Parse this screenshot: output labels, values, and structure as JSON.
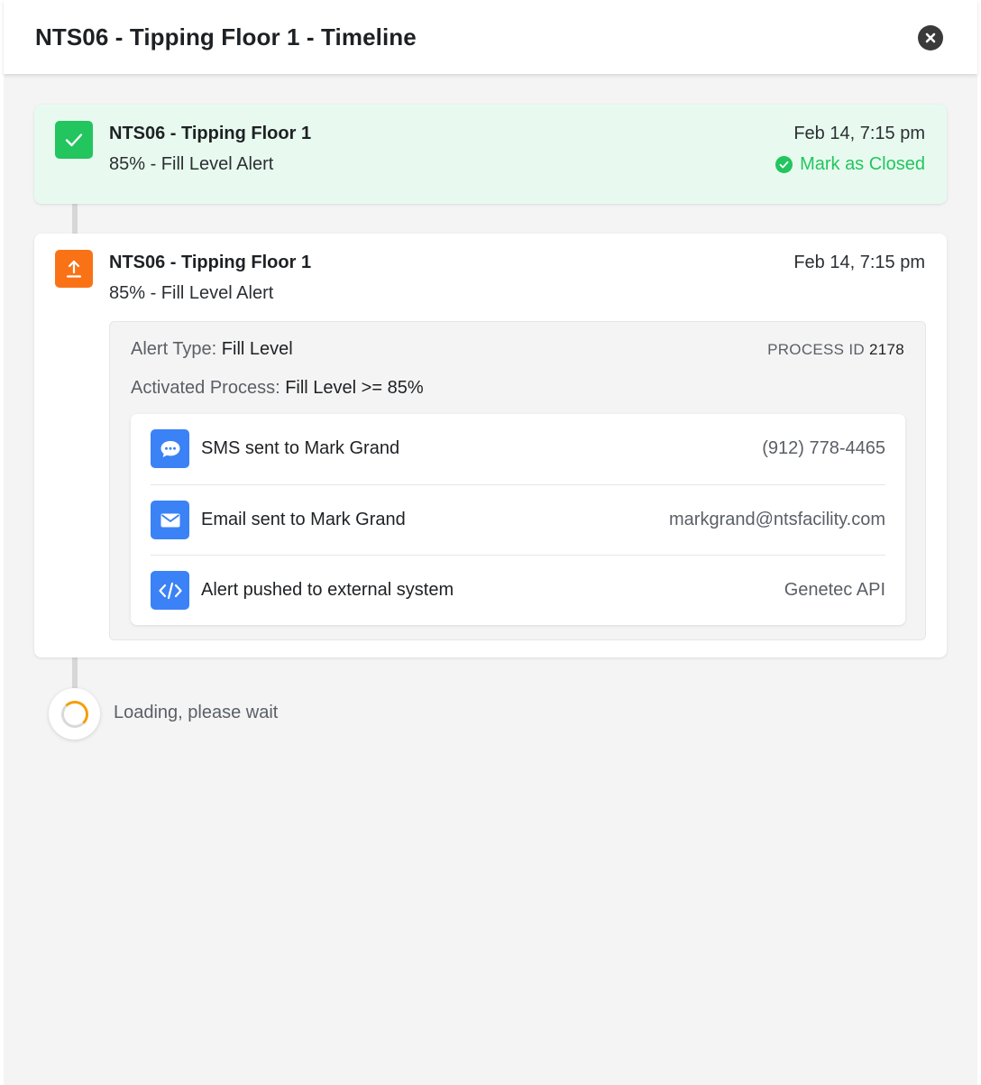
{
  "modal": {
    "title": "NTS06 - Tipping Floor 1 - Timeline",
    "close_icon": "close-circle-icon"
  },
  "colors": {
    "success": "#22c55e",
    "warning": "#f97316",
    "info": "#3b82f6"
  },
  "events": [
    {
      "icon": "check-icon",
      "title": "NTS06 - Tipping Floor 1",
      "subtitle": "85% - Fill Level Alert",
      "time": "Feb 14, 7:15 pm",
      "action_label": "Mark as Closed"
    },
    {
      "icon": "upload-icon",
      "title": "NTS06 - Tipping Floor 1",
      "subtitle": "85% - Fill Level Alert",
      "time": "Feb 14, 7:15 pm",
      "details": {
        "alert_type_label": "Alert Type:",
        "alert_type_value": "Fill Level",
        "process_label": "Activated Process:",
        "process_value": "Fill Level >= 85%",
        "process_id_label": "PROCESS ID",
        "process_id_value": "2178",
        "actions": [
          {
            "icon": "chat-bubble-icon",
            "label": "SMS sent to Mark Grand",
            "value": "(912) 778-4465"
          },
          {
            "icon": "envelope-icon",
            "label": "Email sent to Mark Grand",
            "value": "markgrand@ntsfacility.com"
          },
          {
            "icon": "code-icon",
            "label": "Alert pushed to external system",
            "value": "Genetec API"
          }
        ]
      }
    }
  ],
  "loading": {
    "text": "Loading, please wait"
  }
}
